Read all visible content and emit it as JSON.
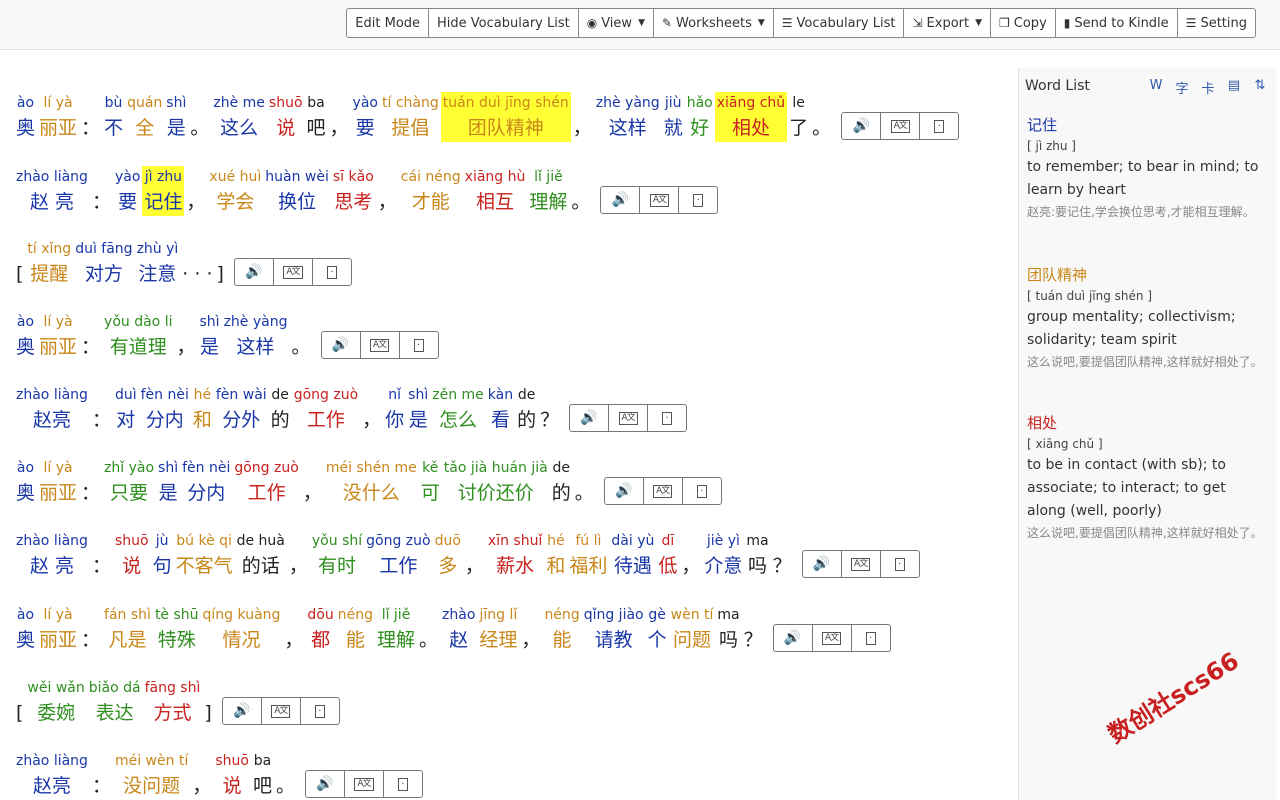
{
  "toolbar": {
    "buttons": [
      {
        "label": "Edit Mode",
        "icon": "",
        "caret": false
      },
      {
        "label": "Hide Vocabulary List",
        "icon": "",
        "caret": false
      },
      {
        "label": "View",
        "icon": "eye-icon",
        "caret": true
      },
      {
        "label": "Worksheets",
        "icon": "edit-icon",
        "caret": true
      },
      {
        "label": "Vocabulary List",
        "icon": "list-icon",
        "caret": false
      },
      {
        "label": "Export",
        "icon": "export-icon",
        "caret": true
      },
      {
        "label": "Copy",
        "icon": "copy-icon",
        "caret": false
      },
      {
        "label": "Send to Kindle",
        "icon": "kindle-icon",
        "caret": false
      },
      {
        "label": "Setting",
        "icon": "sliders-icon",
        "caret": false
      }
    ]
  },
  "lines": [
    [
      {
        "py": "ào",
        "hz": "奥",
        "c": "blue"
      },
      {
        "py": "lí yà",
        "hz": "丽亚",
        "c": "orange"
      },
      {
        "py": "",
        "hz": "：",
        "c": "black",
        "p": 1
      },
      {
        "py": "bù",
        "hz": "不",
        "c": "blue"
      },
      {
        "py": "quán",
        "hz": "全",
        "c": "orange"
      },
      {
        "py": "shì",
        "hz": "是",
        "c": "blue"
      },
      {
        "py": "",
        "hz": "。",
        "c": "black",
        "p": 1
      },
      {
        "py": "zhè me",
        "hz": "这么",
        "c": "blue"
      },
      {
        "py": "shuō",
        "hz": "说",
        "c": "red"
      },
      {
        "py": "ba",
        "hz": "吧",
        "c": "black"
      },
      {
        "py": "",
        "hz": "，",
        "c": "black",
        "p": 1
      },
      {
        "py": "yào",
        "hz": "要",
        "c": "blue"
      },
      {
        "py": "tí chàng",
        "hz": "提倡",
        "c": "orange"
      },
      {
        "py": "tuán duì jīng shén",
        "hz": "团队精神",
        "c": "orange",
        "hl": 1
      },
      {
        "py": "",
        "hz": "，",
        "c": "black",
        "p": 1
      },
      {
        "py": "zhè yàng",
        "hz": "这样",
        "c": "blue"
      },
      {
        "py": "jiù",
        "hz": "就",
        "c": "blue"
      },
      {
        "py": "hǎo",
        "hz": "好",
        "c": "green"
      },
      {
        "py": "xiāng chǔ",
        "hz": "相处",
        "c": "red",
        "hl": 1
      },
      {
        "py": "le",
        "hz": "了",
        "c": "black"
      },
      {
        "py": "",
        "hz": "。",
        "c": "black",
        "p": 1
      }
    ],
    [
      {
        "py": "zhào liàng",
        "hz": "赵 亮",
        "c": "blue"
      },
      {
        "py": "",
        "hz": "：",
        "c": "black",
        "p": 1
      },
      {
        "py": "yào",
        "hz": "要",
        "c": "blue"
      },
      {
        "py": "jì zhu",
        "hz": "记住",
        "c": "blue",
        "hl": 1
      },
      {
        "py": "",
        "hz": "，",
        "c": "black",
        "p": 1
      },
      {
        "py": "xué huì",
        "hz": "学会",
        "c": "orange"
      },
      {
        "py": "huàn wèi",
        "hz": "换位",
        "c": "blue"
      },
      {
        "py": "sī kǎo",
        "hz": "思考",
        "c": "red"
      },
      {
        "py": "",
        "hz": "，",
        "c": "black",
        "p": 1
      },
      {
        "py": "cái néng",
        "hz": "才能",
        "c": "orange"
      },
      {
        "py": "xiāng hù",
        "hz": "相互",
        "c": "red"
      },
      {
        "py": "lǐ jiě",
        "hz": "理解",
        "c": "green"
      },
      {
        "py": "",
        "hz": "。",
        "c": "black",
        "p": 1
      }
    ],
    [
      {
        "py": "",
        "hz": "[",
        "c": "black",
        "p": 1
      },
      {
        "py": "tí xǐng",
        "hz": "提醒",
        "c": "orange"
      },
      {
        "py": "duì fāng",
        "hz": "对方",
        "c": "blue"
      },
      {
        "py": "zhù yì",
        "hz": "注意",
        "c": "blue"
      },
      {
        "py": "",
        "hz": "·  ·  ·",
        "c": "black",
        "p": 1
      },
      {
        "py": "",
        "hz": "]",
        "c": "black",
        "p": 1
      }
    ],
    [
      {
        "py": "ào",
        "hz": "奥",
        "c": "blue"
      },
      {
        "py": "lí yà",
        "hz": "丽亚",
        "c": "orange"
      },
      {
        "py": "",
        "hz": "：",
        "c": "black",
        "p": 1
      },
      {
        "py": "yǒu dào li",
        "hz": "有道理",
        "c": "green"
      },
      {
        "py": "",
        "hz": "，",
        "c": "black",
        "p": 1
      },
      {
        "py": "shì",
        "hz": "是",
        "c": "blue"
      },
      {
        "py": "zhè yàng",
        "hz": "这样",
        "c": "blue"
      },
      {
        "py": "",
        "hz": "。",
        "c": "black",
        "p": 1
      }
    ],
    [
      {
        "py": "zhào liàng",
        "hz": "赵亮",
        "c": "blue"
      },
      {
        "py": "",
        "hz": "：",
        "c": "black",
        "p": 1
      },
      {
        "py": "duì",
        "hz": "对",
        "c": "blue"
      },
      {
        "py": "fèn nèi",
        "hz": "分内",
        "c": "blue"
      },
      {
        "py": "hé",
        "hz": "和",
        "c": "orange"
      },
      {
        "py": "fèn wài",
        "hz": "分外",
        "c": "blue"
      },
      {
        "py": "de",
        "hz": "的",
        "c": "black"
      },
      {
        "py": "gōng zuò",
        "hz": "工作",
        "c": "red"
      },
      {
        "py": "",
        "hz": "，",
        "c": "black",
        "p": 1
      },
      {
        "py": "nǐ",
        "hz": "你",
        "c": "blue"
      },
      {
        "py": "shì",
        "hz": "是",
        "c": "blue"
      },
      {
        "py": "zěn me",
        "hz": "怎么",
        "c": "green"
      },
      {
        "py": "kàn",
        "hz": "看",
        "c": "blue"
      },
      {
        "py": "de",
        "hz": "的",
        "c": "black"
      },
      {
        "py": "",
        "hz": "？",
        "c": "black",
        "p": 1
      }
    ],
    [
      {
        "py": "ào",
        "hz": "奥",
        "c": "blue"
      },
      {
        "py": "lí yà",
        "hz": "丽亚",
        "c": "orange"
      },
      {
        "py": "",
        "hz": "：",
        "c": "black",
        "p": 1
      },
      {
        "py": "zhǐ yào",
        "hz": "只要",
        "c": "green"
      },
      {
        "py": "shì",
        "hz": "是",
        "c": "blue"
      },
      {
        "py": "fèn nèi",
        "hz": "分内",
        "c": "blue"
      },
      {
        "py": "gōng zuò",
        "hz": "工作",
        "c": "red"
      },
      {
        "py": "",
        "hz": "，",
        "c": "black",
        "p": 1
      },
      {
        "py": "méi shén me",
        "hz": "没什么",
        "c": "orange"
      },
      {
        "py": "kě",
        "hz": "可",
        "c": "green"
      },
      {
        "py": "tǎo jià huán jià",
        "hz": "讨价还价",
        "c": "green"
      },
      {
        "py": "de",
        "hz": "的",
        "c": "black"
      },
      {
        "py": "",
        "hz": "。",
        "c": "black",
        "p": 1
      }
    ],
    [
      {
        "py": "zhào liàng",
        "hz": "赵 亮",
        "c": "blue"
      },
      {
        "py": "",
        "hz": "：",
        "c": "black",
        "p": 1
      },
      {
        "py": "shuō",
        "hz": "说",
        "c": "red"
      },
      {
        "py": "jù",
        "hz": "句",
        "c": "blue"
      },
      {
        "py": "bú kè qi",
        "hz": "不客气",
        "c": "orange"
      },
      {
        "py": "de huà",
        "hz": "的话",
        "c": "black"
      },
      {
        "py": "",
        "hz": "，",
        "c": "black",
        "p": 1
      },
      {
        "py": "yǒu shí",
        "hz": "有时",
        "c": "green"
      },
      {
        "py": "gōng zuò",
        "hz": "工作",
        "c": "blue"
      },
      {
        "py": "duō",
        "hz": "多",
        "c": "orange"
      },
      {
        "py": "",
        "hz": "，",
        "c": "black",
        "p": 1
      },
      {
        "py": "xīn shuǐ",
        "hz": "薪水",
        "c": "red"
      },
      {
        "py": "hé",
        "hz": "和",
        "c": "orange"
      },
      {
        "py": "fú lì",
        "hz": "福利",
        "c": "orange"
      },
      {
        "py": "dài yù",
        "hz": "待遇",
        "c": "blue"
      },
      {
        "py": "dī",
        "hz": "低",
        "c": "red"
      },
      {
        "py": "",
        "hz": "，",
        "c": "black",
        "p": 1
      },
      {
        "py": "jiè yì",
        "hz": "介意",
        "c": "blue"
      },
      {
        "py": "ma",
        "hz": "吗",
        "c": "black"
      },
      {
        "py": "",
        "hz": "？",
        "c": "black",
        "p": 1
      }
    ],
    [
      {
        "py": "ào",
        "hz": "奥",
        "c": "blue"
      },
      {
        "py": "lí yà",
        "hz": "丽亚",
        "c": "orange"
      },
      {
        "py": "",
        "hz": "：",
        "c": "black",
        "p": 1
      },
      {
        "py": "fán shì",
        "hz": "凡是",
        "c": "orange"
      },
      {
        "py": "tè shū",
        "hz": "特殊",
        "c": "green"
      },
      {
        "py": "qíng kuàng",
        "hz": "情况",
        "c": "orange"
      },
      {
        "py": "",
        "hz": "，",
        "c": "black",
        "p": 1
      },
      {
        "py": "dōu",
        "hz": "都",
        "c": "red"
      },
      {
        "py": "néng",
        "hz": "能",
        "c": "orange"
      },
      {
        "py": "lǐ jiě",
        "hz": "理解",
        "c": "green"
      },
      {
        "py": "",
        "hz": "。",
        "c": "black",
        "p": 1
      },
      {
        "py": "zhào",
        "hz": "赵",
        "c": "blue"
      },
      {
        "py": "jīng lǐ",
        "hz": "经理",
        "c": "orange"
      },
      {
        "py": "",
        "hz": "，",
        "c": "black",
        "p": 1
      },
      {
        "py": "néng",
        "hz": "能",
        "c": "orange"
      },
      {
        "py": "qǐng jiào",
        "hz": "请教",
        "c": "blue"
      },
      {
        "py": "gè",
        "hz": "个",
        "c": "blue"
      },
      {
        "py": "wèn tí",
        "hz": "问题",
        "c": "orange"
      },
      {
        "py": "ma",
        "hz": "吗",
        "c": "black"
      },
      {
        "py": "",
        "hz": "？",
        "c": "black",
        "p": 1
      }
    ],
    [
      {
        "py": "",
        "hz": "[",
        "c": "black",
        "p": 1
      },
      {
        "py": "wěi wǎn",
        "hz": "委婉",
        "c": "green"
      },
      {
        "py": "biǎo dá",
        "hz": "表达",
        "c": "green"
      },
      {
        "py": "fāng shì",
        "hz": "方式",
        "c": "red"
      },
      {
        "py": "",
        "hz": "]",
        "c": "black",
        "p": 1
      }
    ],
    [
      {
        "py": "zhào liàng",
        "hz": "赵亮",
        "c": "blue"
      },
      {
        "py": "",
        "hz": "：",
        "c": "black",
        "p": 1
      },
      {
        "py": "méi wèn tí",
        "hz": "没问题",
        "c": "orange"
      },
      {
        "py": "",
        "hz": "，",
        "c": "black",
        "p": 1
      },
      {
        "py": "shuō",
        "hz": "说",
        "c": "red"
      },
      {
        "py": "ba",
        "hz": "吧",
        "c": "black"
      },
      {
        "py": "",
        "hz": "。",
        "c": "black",
        "p": 1
      }
    ]
  ],
  "sidebar": {
    "title": "Word List",
    "icons": [
      "word-export-icon",
      "character-icon",
      "flashcard-icon",
      "slides-icon",
      "sort-icon"
    ],
    "entries": [
      {
        "word": "记住",
        "pinyin": "[ jì zhu ]",
        "definition": "to remember; to bear in mind; to learn by heart",
        "example": "赵亮:要记住,学会换位思考,才能相互理解。"
      },
      {
        "word": "团队精神",
        "pinyin": "[ tuán duì jīng shén ]",
        "definition": "group mentality; collectivism; solidarity; team spirit",
        "example": "这么说吧,要提倡团队精神,这样就好相处了。"
      },
      {
        "word": "相处",
        "pinyin": "[ xiāng chǔ ]",
        "definition": "to be in contact (with sb); to associate; to interact; to get along (well, poorly)",
        "example": "这么说吧,要提倡团队精神,这样就好相处了。"
      }
    ]
  },
  "watermark": "数创社scs66",
  "colors": {
    "blue": "#1a37a8",
    "red": "#c8231f",
    "orange": "#c9871a",
    "green": "#2f8f1f",
    "highlight": "#ffff33"
  }
}
